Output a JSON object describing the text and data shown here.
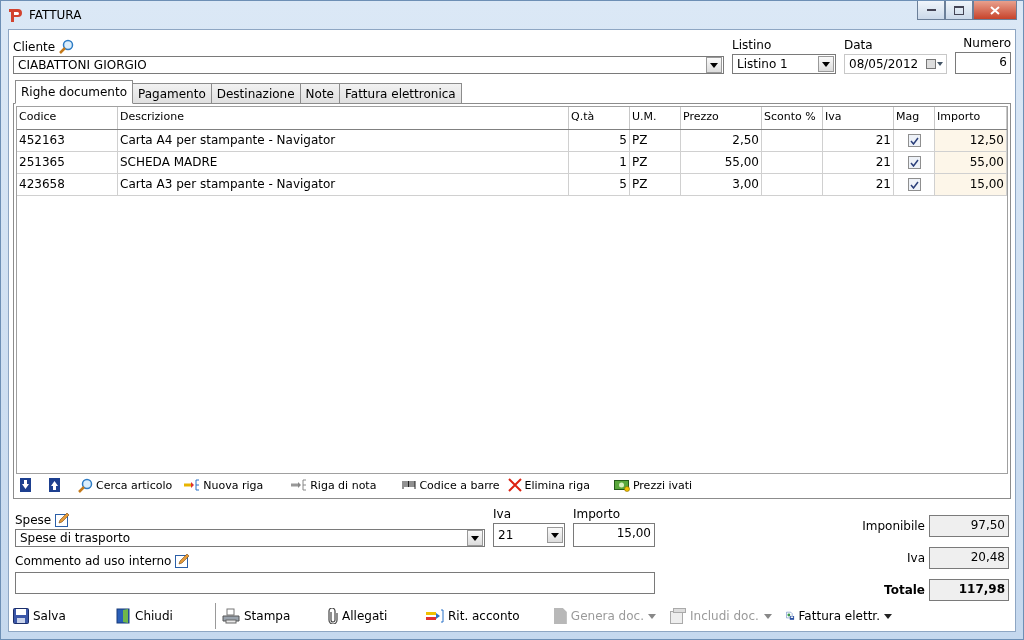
{
  "window": {
    "title": "FATTURA"
  },
  "header": {
    "cliente": {
      "label": "Cliente",
      "value": "CIABATTONI GIORGIO"
    },
    "listino": {
      "label": "Listino",
      "value": "Listino 1"
    },
    "data": {
      "label": "Data",
      "value": "08/05/2012"
    },
    "numero": {
      "label": "Numero",
      "value": "6"
    }
  },
  "tabs": [
    {
      "label": "Righe documento",
      "selected": true
    },
    {
      "label": "Pagamento",
      "selected": false
    },
    {
      "label": "Destinazione",
      "selected": false
    },
    {
      "label": "Note",
      "selected": false
    },
    {
      "label": "Fattura elettronica",
      "selected": false
    }
  ],
  "table": {
    "columns": [
      "Codice",
      "Descrizione",
      "Q.tà",
      "U.M.",
      "Prezzo",
      "Sconto %",
      "Iva",
      "Mag",
      "Importo"
    ],
    "rows": [
      {
        "codice": "452163",
        "descrizione": "Carta A4 per stampante - Navigator",
        "qta": "5",
        "um": "PZ",
        "prezzo": "2,50",
        "iva": "21",
        "mag": true,
        "importo": "12,50"
      },
      {
        "codice": "251365",
        "descrizione": "SCHEDA MADRE",
        "qta": "1",
        "um": "PZ",
        "prezzo": "55,00",
        "iva": "21",
        "mag": true,
        "importo": "55,00"
      },
      {
        "codice": "423658",
        "descrizione": "Carta A3 per stampante - Navigator",
        "qta": "5",
        "um": "PZ",
        "prezzo": "3,00",
        "iva": "21",
        "mag": true,
        "importo": "15,00"
      }
    ]
  },
  "grid_toolbar": [
    {
      "kind": "down"
    },
    {
      "kind": "up"
    },
    {
      "kind": "search",
      "label": "Cerca articolo"
    },
    {
      "kind": "newrow",
      "label": "Nuova riga"
    },
    {
      "kind": "noterow",
      "label": "Riga di nota"
    },
    {
      "kind": "barcode",
      "label": "Codice a barre"
    },
    {
      "kind": "delete",
      "label": "Elimina riga"
    },
    {
      "kind": "money",
      "label": "Prezzi ivati"
    }
  ],
  "spese": {
    "label": "Spese",
    "value": "Spese di trasporto",
    "iva_label": "Iva",
    "iva": "21",
    "importo_label": "Importo",
    "importo": "15,00"
  },
  "commento": {
    "label": "Commento ad uso interno"
  },
  "totals": [
    {
      "label": "Imponibile",
      "value": "97,50",
      "bold": false
    },
    {
      "label": "Iva",
      "value": "20,48",
      "bold": false
    },
    {
      "label": "Totale",
      "value": "117,98",
      "bold": true
    }
  ],
  "actions": [
    {
      "kind": "save",
      "label": "Salva",
      "disabled": false,
      "dropdown": false
    },
    {
      "kind": "close",
      "label": "Chiudi",
      "disabled": false,
      "dropdown": false
    },
    {
      "kind": "print",
      "label": "Stampa",
      "disabled": false,
      "dropdown": false
    },
    {
      "kind": "attach",
      "label": "Allegati",
      "disabled": false,
      "dropdown": false
    },
    {
      "kind": "withhold",
      "label": "Rit. acconto",
      "disabled": false,
      "dropdown": false
    },
    {
      "kind": "generate",
      "label": "Genera doc.",
      "disabled": true,
      "dropdown": true
    },
    {
      "kind": "include",
      "label": "Includi doc.",
      "disabled": true,
      "dropdown": true
    },
    {
      "kind": "einvoice",
      "label": "Fattura elettr.",
      "disabled": false,
      "dropdown": true
    }
  ]
}
